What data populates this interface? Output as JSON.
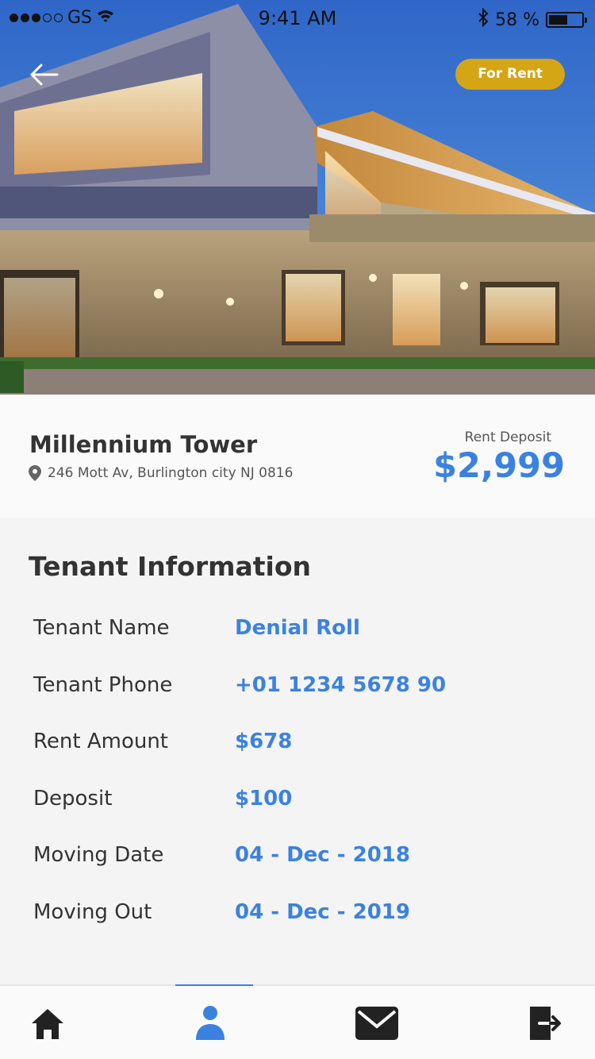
{
  "status_bar": {
    "carrier": "GS",
    "time": "9:41 AM",
    "battery_text": "58 %",
    "battery_level": 0.58
  },
  "hero": {
    "badge_label": "For Rent"
  },
  "property": {
    "name": "Millennium Tower",
    "address": "246 Mott Av, Burlington city NJ 0816",
    "deposit_label": "Rent Deposit",
    "deposit_value": "$2,999"
  },
  "tenant": {
    "section_title": "Tenant Information",
    "rows": [
      {
        "label": "Tenant Name",
        "value": "Denial Roll"
      },
      {
        "label": "Tenant Phone",
        "value": "+01 1234 5678 90"
      },
      {
        "label": "Rent Amount",
        "value": "$678"
      },
      {
        "label": "Deposit",
        "value": "$100"
      },
      {
        "label": "Moving Date",
        "value": "04 - Dec - 2018"
      },
      {
        "label": "Moving Out",
        "value": "04 - Dec - 2019"
      }
    ]
  },
  "tabs": [
    {
      "icon": "home-icon",
      "active": false
    },
    {
      "icon": "profile-icon",
      "active": true
    },
    {
      "icon": "mail-icon",
      "active": false
    },
    {
      "icon": "logout-icon",
      "active": false
    }
  ],
  "colors": {
    "accent": "#3b82e0",
    "badge": "#d4a514",
    "text_dark": "#333333"
  }
}
